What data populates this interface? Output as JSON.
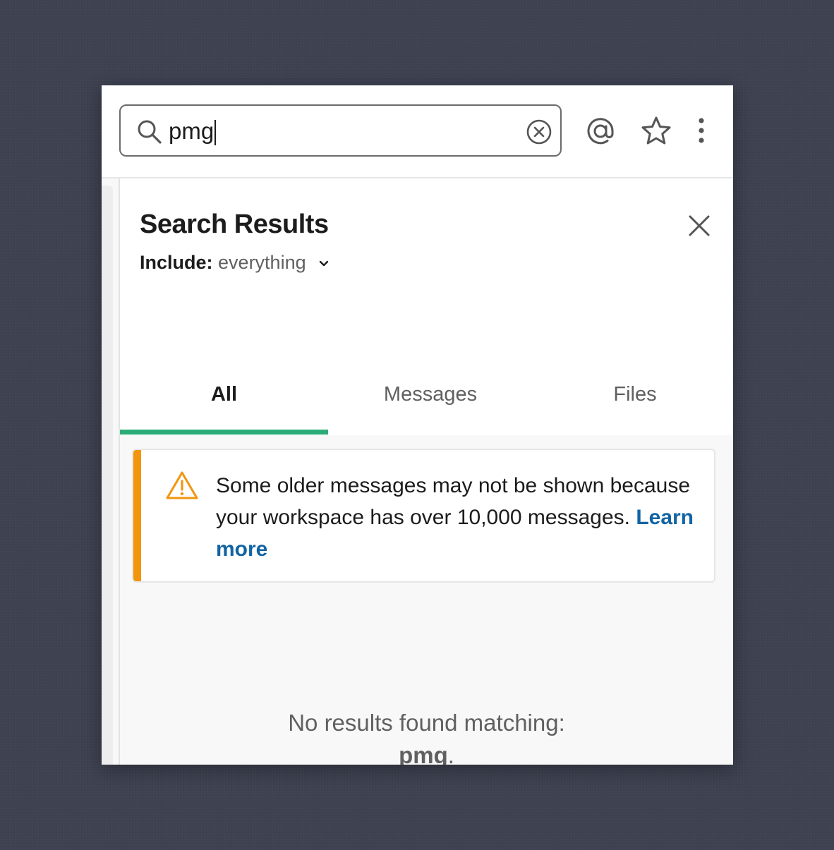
{
  "search": {
    "query": "pmg"
  },
  "panel": {
    "title": "Search Results",
    "include_label": "Include:",
    "include_value": "everything"
  },
  "tabs": [
    {
      "label": "All",
      "active": true
    },
    {
      "label": "Messages",
      "active": false
    },
    {
      "label": "Files",
      "active": false
    }
  ],
  "warning": {
    "text": "Some older messages may not be shown because your workspace has over 10,000 messages. ",
    "link": "Learn more"
  },
  "empty_state": {
    "line1": "No results found matching:",
    "term": "pmg",
    "suffix": "."
  },
  "icons": {
    "search": "search-icon",
    "clear": "clear-circle-x-icon",
    "mentions": "at-sign-icon",
    "saved": "star-icon",
    "more": "vertical-ellipsis-icon",
    "close": "close-x-icon",
    "include_dropdown": "chevron-down-icon",
    "warning": "warning-triangle-icon"
  },
  "colors": {
    "background": "#3d4150",
    "active_tab_underline": "#2bac76",
    "warning_accent": "#f2950d",
    "warning_icon": "#f2950d",
    "link": "#1264a3"
  }
}
